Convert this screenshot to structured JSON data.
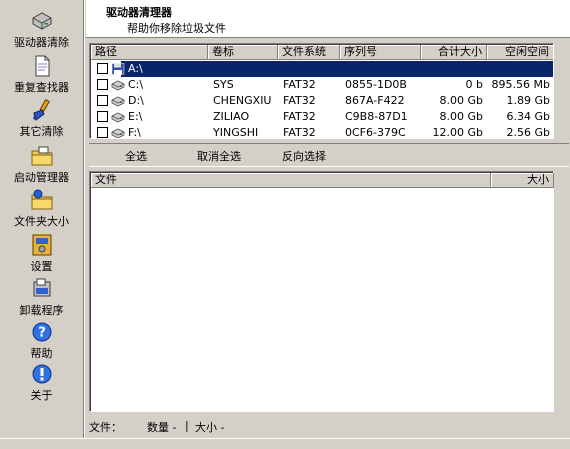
{
  "sidebar": {
    "items": [
      {
        "label": "驱动器清除",
        "icon": "drive-icon"
      },
      {
        "label": "重复查找器",
        "icon": "document-icon"
      },
      {
        "label": "其它清除",
        "icon": "brush-icon"
      },
      {
        "label": "启动管理器",
        "icon": "folder-startup-icon"
      },
      {
        "label": "文件夹大小",
        "icon": "folder-size-icon"
      },
      {
        "label": "设置",
        "icon": "settings-icon"
      },
      {
        "label": "卸载程序",
        "icon": "uninstall-icon"
      },
      {
        "label": "帮助",
        "icon": "help-icon"
      },
      {
        "label": "关于",
        "icon": "info-icon"
      }
    ]
  },
  "header": {
    "title": "驱动器清理器",
    "subtitle": "帮助你移除垃圾文件"
  },
  "drives": {
    "columns": [
      "路径",
      "卷标",
      "文件系统",
      "序列号",
      "合计大小",
      "空闲空间"
    ],
    "rows": [
      {
        "path": "A:\\",
        "label": "",
        "fs": "",
        "serial": "",
        "total": "",
        "free": "",
        "selected": true,
        "icon": "floppy-icon"
      },
      {
        "path": "C:\\",
        "label": "SYS",
        "fs": "FAT32",
        "serial": "0855-1D0B",
        "total": "0 b",
        "free": "895.56 Mb",
        "selected": false,
        "icon": "hard-drive-icon"
      },
      {
        "path": "D:\\",
        "label": "CHENGXIU",
        "fs": "FAT32",
        "serial": "867A-F422",
        "total": "8.00 Gb",
        "free": "1.89 Gb",
        "selected": false,
        "icon": "hard-drive-icon"
      },
      {
        "path": "E:\\",
        "label": "ZILIAO",
        "fs": "FAT32",
        "serial": "C9B8-87D1",
        "total": "8.00 Gb",
        "free": "6.34 Gb",
        "selected": false,
        "icon": "hard-drive-icon"
      },
      {
        "path": "F:\\",
        "label": "YINGSHI",
        "fs": "FAT32",
        "serial": "0CF6-379C",
        "total": "12.00 Gb",
        "free": "2.56 Gb",
        "selected": false,
        "icon": "hard-drive-icon"
      }
    ]
  },
  "actions": {
    "select_all": "全选",
    "deselect_all": "取消全选",
    "invert": "反向选择"
  },
  "files": {
    "columns": [
      "文件",
      "大小"
    ]
  },
  "status": {
    "files_label": "文件：",
    "count_label": "数量 -",
    "separator": "|",
    "size_label": "大小 -"
  },
  "colors": {
    "selection": "#0a246a",
    "face": "#d4d0c8"
  }
}
